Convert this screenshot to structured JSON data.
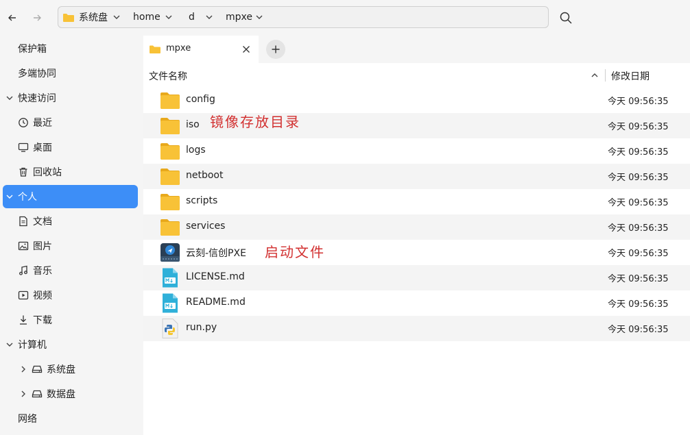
{
  "toolbar": {
    "breadcrumbs": [
      {
        "label": "系统盘"
      },
      {
        "label": "home"
      },
      {
        "label": "d"
      },
      {
        "label": "mpxe"
      }
    ]
  },
  "sidebar": {
    "items": [
      {
        "label": "保护箱",
        "icon": "none"
      },
      {
        "label": "多端协同",
        "icon": "none"
      },
      {
        "label": "快速访问",
        "icon": "chevron-down"
      },
      {
        "label": "最近",
        "icon": "clock-icon"
      },
      {
        "label": "桌面",
        "icon": "monitor-icon"
      },
      {
        "label": "回收站",
        "icon": "trash-icon"
      },
      {
        "label": "个人",
        "icon": "chevron-down",
        "active": true
      },
      {
        "label": "文档",
        "icon": "document-icon"
      },
      {
        "label": "图片",
        "icon": "image-icon"
      },
      {
        "label": "音乐",
        "icon": "music-icon"
      },
      {
        "label": "视频",
        "icon": "video-icon"
      },
      {
        "label": "下载",
        "icon": "download-icon"
      },
      {
        "label": "计算机",
        "icon": "chevron-down"
      },
      {
        "label": "系统盘",
        "icon": "drive-icon"
      },
      {
        "label": "数据盘",
        "icon": "drive-icon"
      },
      {
        "label": "网络",
        "icon": "none"
      }
    ]
  },
  "tabs": [
    {
      "label": "mpxe",
      "icon": "folder-icon"
    }
  ],
  "list": {
    "columns": {
      "name": "文件名称",
      "modified": "修改日期"
    },
    "rows": [
      {
        "name": "config",
        "modified": "今天 09:56:35",
        "type": "folder"
      },
      {
        "name": "iso",
        "modified": "今天 09:56:35",
        "type": "folder"
      },
      {
        "name": "logs",
        "modified": "今天 09:56:35",
        "type": "folder"
      },
      {
        "name": "netboot",
        "modified": "今天 09:56:35",
        "type": "folder"
      },
      {
        "name": "scripts",
        "modified": "今天 09:56:35",
        "type": "folder"
      },
      {
        "name": "services",
        "modified": "今天 09:56:35",
        "type": "folder"
      },
      {
        "name": "云刻-信创PXE",
        "modified": "今天 09:56:35",
        "type": "executable"
      },
      {
        "name": "LICENSE.md",
        "modified": "今天 09:56:35",
        "type": "markdown"
      },
      {
        "name": "README.md",
        "modified": "今天 09:56:35",
        "type": "markdown"
      },
      {
        "name": "run.py",
        "modified": "今天 09:56:35",
        "type": "python"
      }
    ]
  },
  "annotations": {
    "iso_note": "镜像存放目录",
    "exec_note": "启动文件"
  },
  "colors": {
    "accent": "#3d8ef7",
    "folder": "#f8c237",
    "annotation": "#d23030"
  }
}
